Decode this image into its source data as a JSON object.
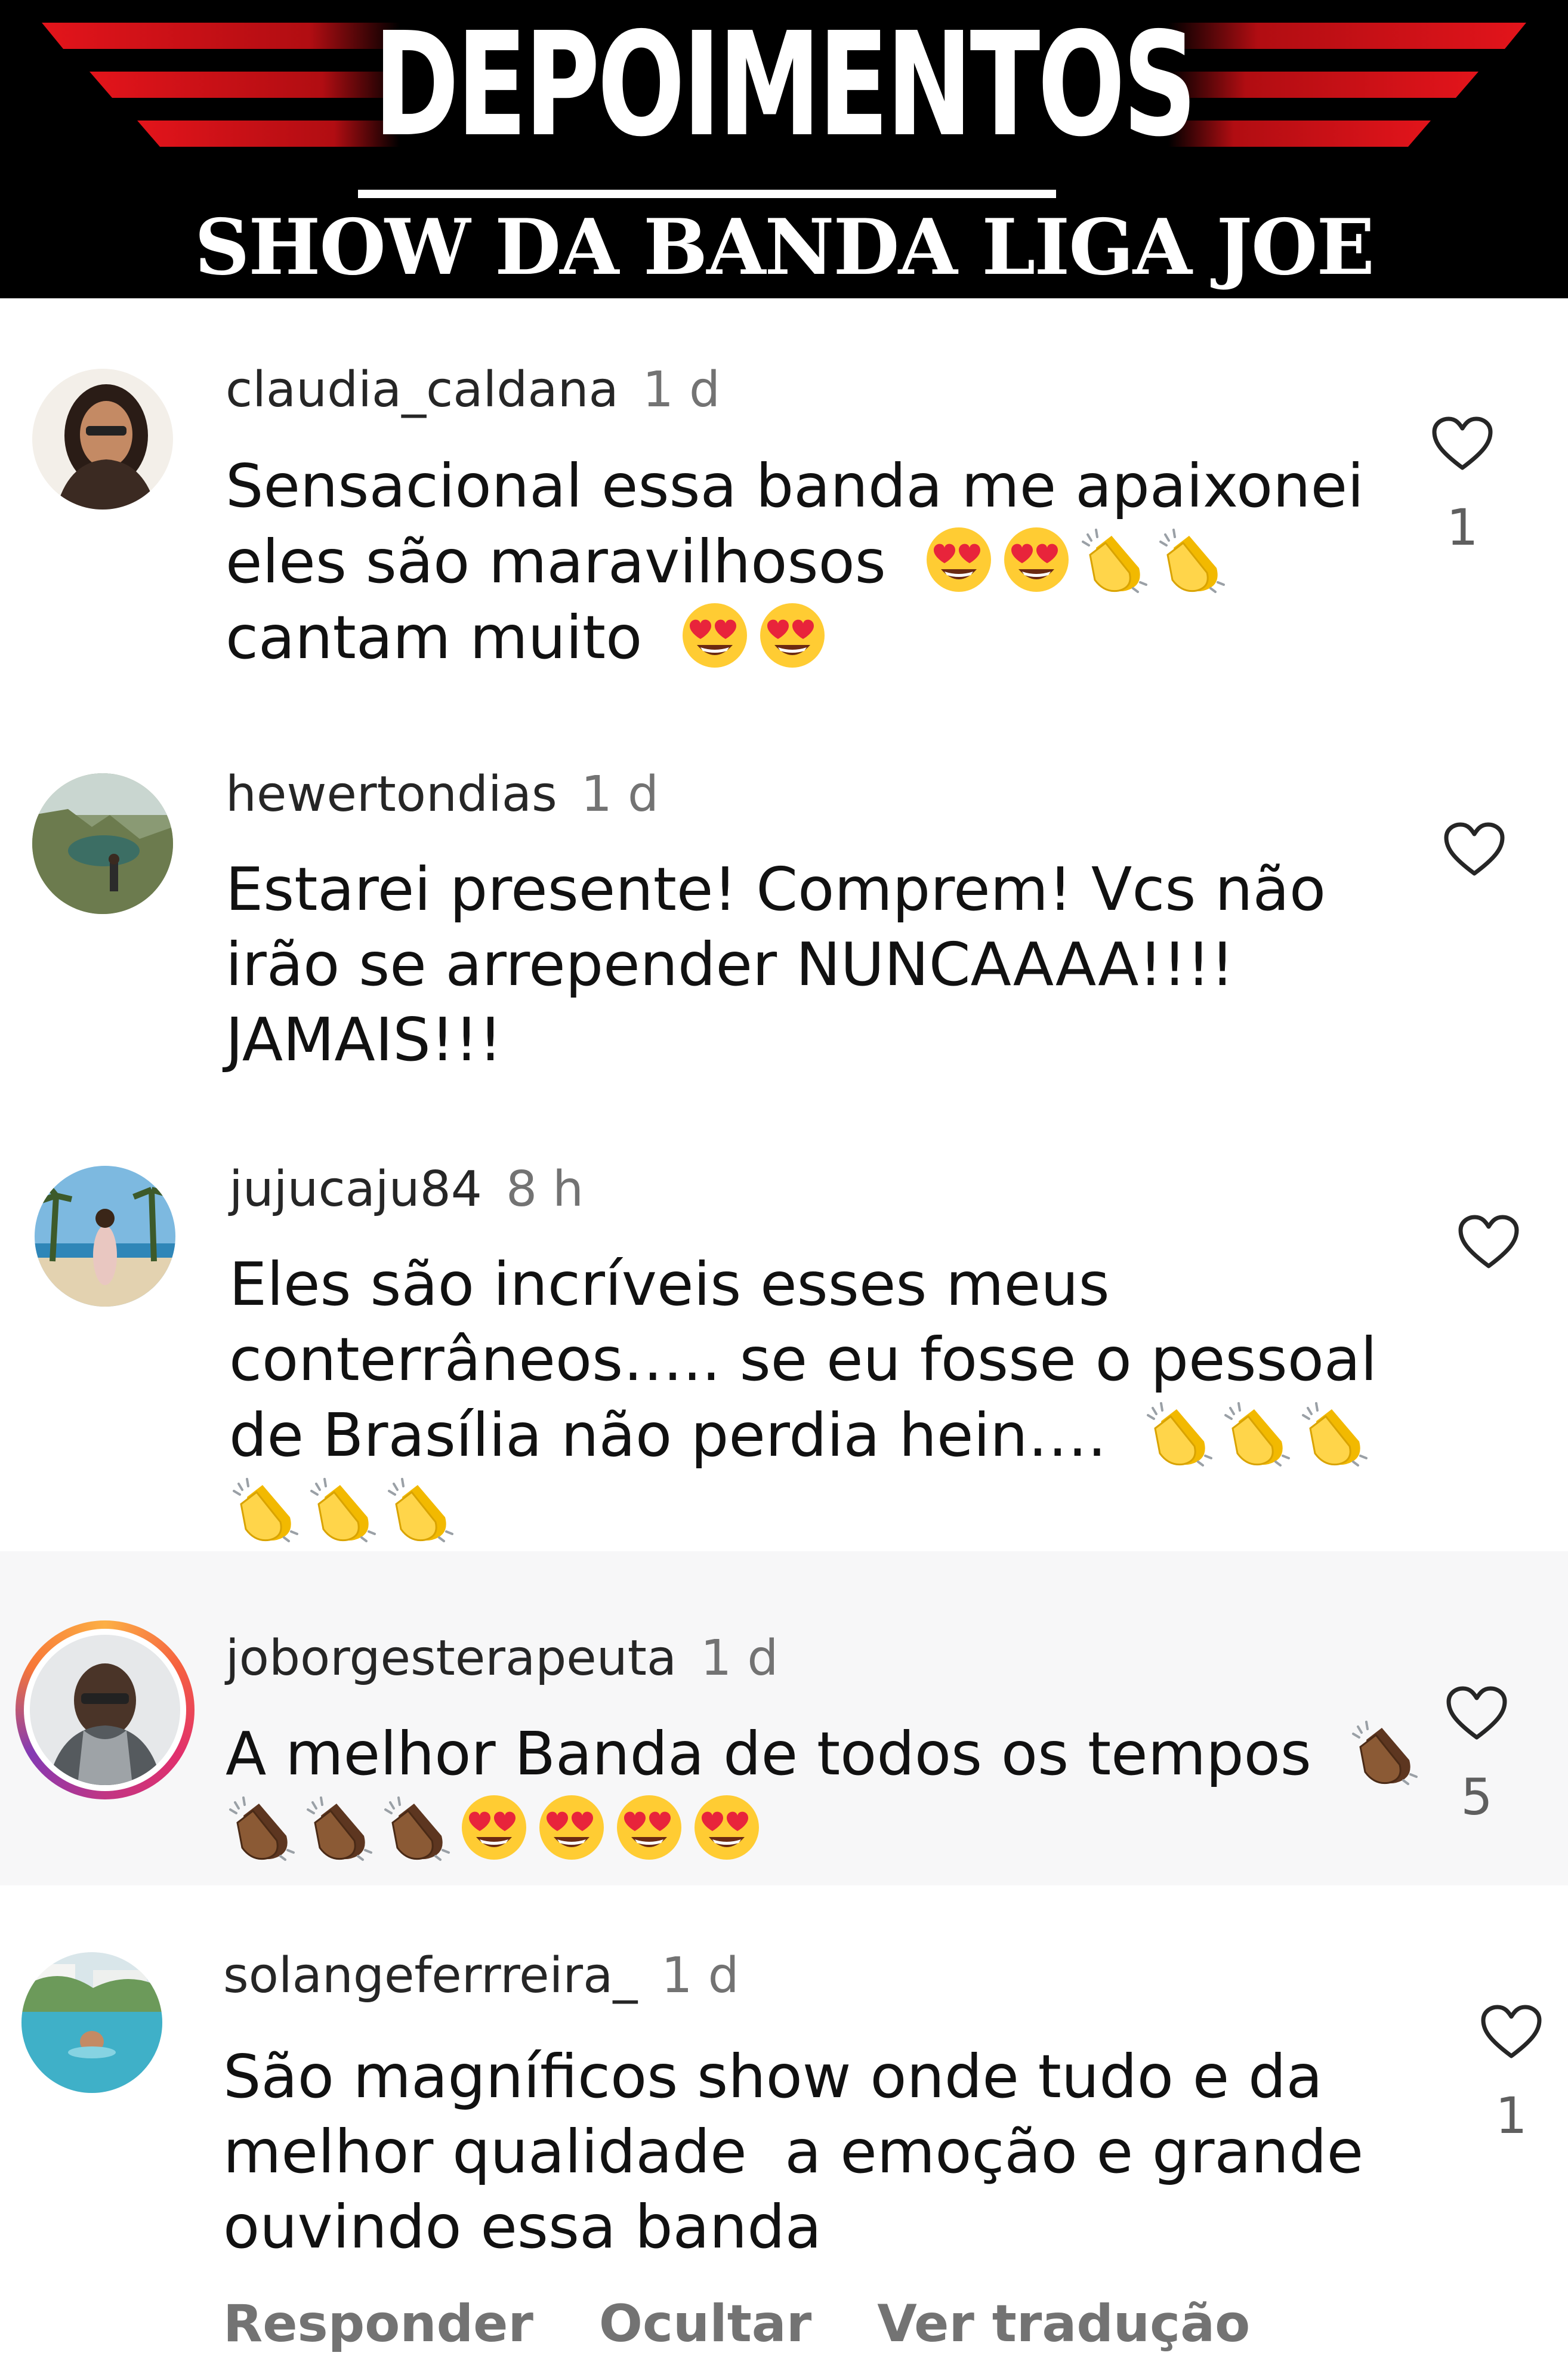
{
  "banner": {
    "title": "DEPOIMENTOS",
    "subtitle": "SHOW DA BANDA LIGA JOE",
    "stripe_colors": [
      "#e3141b",
      "#7a0a0a"
    ]
  },
  "comments": [
    {
      "username": "claudia_caldana",
      "time": "1 d",
      "lines": [
        "Sensacional essa banda me apaixonei",
        "eles são maravilhosos",
        "cantam muito"
      ],
      "likes": "1",
      "emoji_line2": [
        "heart-eyes",
        "heart-eyes",
        "clap",
        "clap"
      ],
      "emoji_line3": [
        "heart-eyes",
        "heart-eyes"
      ]
    },
    {
      "username": "hewertondias",
      "time": "1 d",
      "lines": [
        "Estarei presente! Comprem! Vcs não",
        "irão se arrepender NUNCAAAA!!!!",
        "JAMAIS!!!"
      ],
      "likes": ""
    },
    {
      "username": "jujucaju84",
      "time": "8 h",
      "lines": [
        "Eles são incríveis esses meus",
        "conterrâneos….. se eu fosse o pessoal",
        "de Brasília não perdia hein…."
      ],
      "likes": "",
      "emoji_line3": [
        "clap",
        "clap",
        "clap"
      ],
      "emoji_line4": [
        "clap",
        "clap",
        "clap"
      ]
    },
    {
      "username": "joborgesterapeuta",
      "time": "1 d",
      "lines": [
        "A melhor Banda de todos os tempos"
      ],
      "likes": "5",
      "emoji_line1": [
        "clap-dark"
      ],
      "emoji_line2": [
        "clap-dark",
        "clap-dark",
        "clap-dark",
        "heart-eyes",
        "heart-eyes",
        "heart-eyes",
        "heart-eyes"
      ]
    },
    {
      "username": "solangeferrreira_",
      "time": "1 d",
      "lines": [
        "São magníficos show onde tudo e da",
        "melhor qualidade  a emoção e grande",
        "ouvindo essa banda"
      ],
      "likes": "1"
    }
  ],
  "actions": {
    "reply": "Responder",
    "hide": "Ocultar",
    "translate": "Ver tradução"
  },
  "icons": {
    "like": "heart-outline-icon",
    "emoji_heart_eyes": "heart-eyes-emoji",
    "emoji_clap": "clapping-hands-emoji"
  },
  "colors": {
    "username": "#262626",
    "time": "#737373",
    "heart_outline": "#262626",
    "emoji_yellow": "#ffcc33",
    "emoji_red": "#e8243b",
    "clap_dark": "#7a4a2a"
  }
}
